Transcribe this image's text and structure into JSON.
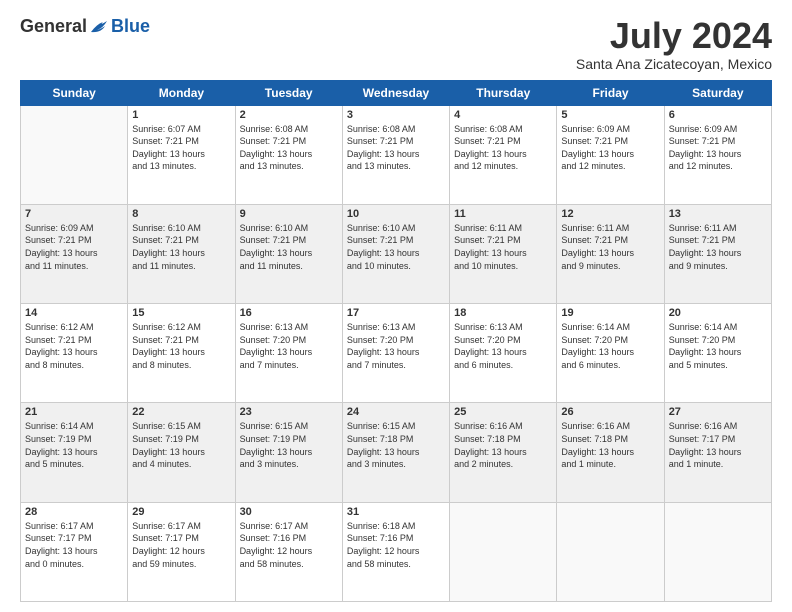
{
  "header": {
    "logo_general": "General",
    "logo_blue": "Blue",
    "month_title": "July 2024",
    "location": "Santa Ana Zicatecoyan, Mexico"
  },
  "days_of_week": [
    "Sunday",
    "Monday",
    "Tuesday",
    "Wednesday",
    "Thursday",
    "Friday",
    "Saturday"
  ],
  "weeks": [
    [
      {
        "day": "",
        "info": ""
      },
      {
        "day": "1",
        "info": "Sunrise: 6:07 AM\nSunset: 7:21 PM\nDaylight: 13 hours\nand 13 minutes."
      },
      {
        "day": "2",
        "info": "Sunrise: 6:08 AM\nSunset: 7:21 PM\nDaylight: 13 hours\nand 13 minutes."
      },
      {
        "day": "3",
        "info": "Sunrise: 6:08 AM\nSunset: 7:21 PM\nDaylight: 13 hours\nand 13 minutes."
      },
      {
        "day": "4",
        "info": "Sunrise: 6:08 AM\nSunset: 7:21 PM\nDaylight: 13 hours\nand 12 minutes."
      },
      {
        "day": "5",
        "info": "Sunrise: 6:09 AM\nSunset: 7:21 PM\nDaylight: 13 hours\nand 12 minutes."
      },
      {
        "day": "6",
        "info": "Sunrise: 6:09 AM\nSunset: 7:21 PM\nDaylight: 13 hours\nand 12 minutes."
      }
    ],
    [
      {
        "day": "7",
        "info": "Sunrise: 6:09 AM\nSunset: 7:21 PM\nDaylight: 13 hours\nand 11 minutes."
      },
      {
        "day": "8",
        "info": "Sunrise: 6:10 AM\nSunset: 7:21 PM\nDaylight: 13 hours\nand 11 minutes."
      },
      {
        "day": "9",
        "info": "Sunrise: 6:10 AM\nSunset: 7:21 PM\nDaylight: 13 hours\nand 11 minutes."
      },
      {
        "day": "10",
        "info": "Sunrise: 6:10 AM\nSunset: 7:21 PM\nDaylight: 13 hours\nand 10 minutes."
      },
      {
        "day": "11",
        "info": "Sunrise: 6:11 AM\nSunset: 7:21 PM\nDaylight: 13 hours\nand 10 minutes."
      },
      {
        "day": "12",
        "info": "Sunrise: 6:11 AM\nSunset: 7:21 PM\nDaylight: 13 hours\nand 9 minutes."
      },
      {
        "day": "13",
        "info": "Sunrise: 6:11 AM\nSunset: 7:21 PM\nDaylight: 13 hours\nand 9 minutes."
      }
    ],
    [
      {
        "day": "14",
        "info": "Sunrise: 6:12 AM\nSunset: 7:21 PM\nDaylight: 13 hours\nand 8 minutes."
      },
      {
        "day": "15",
        "info": "Sunrise: 6:12 AM\nSunset: 7:21 PM\nDaylight: 13 hours\nand 8 minutes."
      },
      {
        "day": "16",
        "info": "Sunrise: 6:13 AM\nSunset: 7:20 PM\nDaylight: 13 hours\nand 7 minutes."
      },
      {
        "day": "17",
        "info": "Sunrise: 6:13 AM\nSunset: 7:20 PM\nDaylight: 13 hours\nand 7 minutes."
      },
      {
        "day": "18",
        "info": "Sunrise: 6:13 AM\nSunset: 7:20 PM\nDaylight: 13 hours\nand 6 minutes."
      },
      {
        "day": "19",
        "info": "Sunrise: 6:14 AM\nSunset: 7:20 PM\nDaylight: 13 hours\nand 6 minutes."
      },
      {
        "day": "20",
        "info": "Sunrise: 6:14 AM\nSunset: 7:20 PM\nDaylight: 13 hours\nand 5 minutes."
      }
    ],
    [
      {
        "day": "21",
        "info": "Sunrise: 6:14 AM\nSunset: 7:19 PM\nDaylight: 13 hours\nand 5 minutes."
      },
      {
        "day": "22",
        "info": "Sunrise: 6:15 AM\nSunset: 7:19 PM\nDaylight: 13 hours\nand 4 minutes."
      },
      {
        "day": "23",
        "info": "Sunrise: 6:15 AM\nSunset: 7:19 PM\nDaylight: 13 hours\nand 3 minutes."
      },
      {
        "day": "24",
        "info": "Sunrise: 6:15 AM\nSunset: 7:18 PM\nDaylight: 13 hours\nand 3 minutes."
      },
      {
        "day": "25",
        "info": "Sunrise: 6:16 AM\nSunset: 7:18 PM\nDaylight: 13 hours\nand 2 minutes."
      },
      {
        "day": "26",
        "info": "Sunrise: 6:16 AM\nSunset: 7:18 PM\nDaylight: 13 hours\nand 1 minute."
      },
      {
        "day": "27",
        "info": "Sunrise: 6:16 AM\nSunset: 7:17 PM\nDaylight: 13 hours\nand 1 minute."
      }
    ],
    [
      {
        "day": "28",
        "info": "Sunrise: 6:17 AM\nSunset: 7:17 PM\nDaylight: 13 hours\nand 0 minutes."
      },
      {
        "day": "29",
        "info": "Sunrise: 6:17 AM\nSunset: 7:17 PM\nDaylight: 12 hours\nand 59 minutes."
      },
      {
        "day": "30",
        "info": "Sunrise: 6:17 AM\nSunset: 7:16 PM\nDaylight: 12 hours\nand 58 minutes."
      },
      {
        "day": "31",
        "info": "Sunrise: 6:18 AM\nSunset: 7:16 PM\nDaylight: 12 hours\nand 58 minutes."
      },
      {
        "day": "",
        "info": ""
      },
      {
        "day": "",
        "info": ""
      },
      {
        "day": "",
        "info": ""
      }
    ]
  ]
}
